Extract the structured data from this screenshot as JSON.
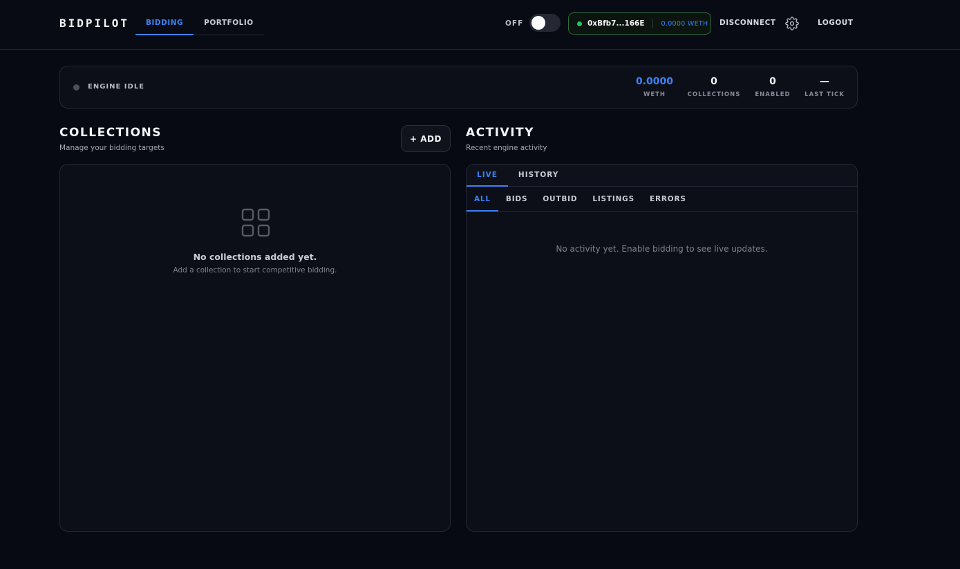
{
  "app": {
    "logo": "BIDPILOT",
    "nav": [
      {
        "label": "BIDDING",
        "active": true
      },
      {
        "label": "PORTFOLIO",
        "active": false
      }
    ],
    "toggle_label": "OFF",
    "wallet": {
      "address": "0xBfb7...166E",
      "balance": "0.0000 WETH"
    },
    "disconnect_label": "DISCONNECT",
    "settings_icon": "gear-icon",
    "logout_label": "LOGOUT"
  },
  "status": {
    "engine": "ENGINE IDLE",
    "stats": [
      {
        "value": "0.0000",
        "label": "WETH"
      },
      {
        "value": "0",
        "label": "COLLECTIONS"
      },
      {
        "value": "0",
        "label": "ENABLED"
      },
      {
        "value": "—",
        "label": "LAST TICK"
      }
    ]
  },
  "collections": {
    "title": "COLLECTIONS",
    "subtitle": "Manage your bidding targets",
    "add_label": "+ ADD",
    "empty_icon": "grid-icon",
    "empty_title": "No collections added yet.",
    "empty_subtitle": "Add a collection to start competitive bidding."
  },
  "activity": {
    "title": "ACTIVITY",
    "subtitle": "Recent engine activity",
    "tabs": [
      {
        "label": "LIVE",
        "active": true
      },
      {
        "label": "HISTORY",
        "active": false
      }
    ],
    "filters": [
      {
        "label": "ALL",
        "active": true
      },
      {
        "label": "BIDS",
        "active": false
      },
      {
        "label": "OUTBID",
        "active": false
      },
      {
        "label": "LISTINGS",
        "active": false
      },
      {
        "label": "ERRORS",
        "active": false
      }
    ],
    "empty": "No activity yet. Enable bidding to see live updates."
  },
  "colors": {
    "accent": "#3b82f6",
    "connected": "#22c55e",
    "background": "#070a12",
    "panel": "#0c0f17"
  }
}
